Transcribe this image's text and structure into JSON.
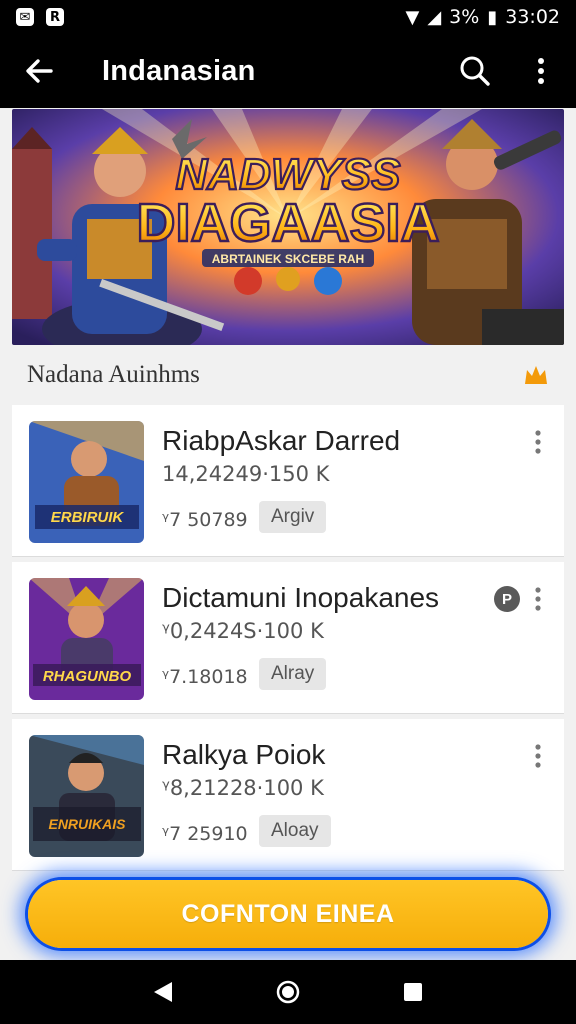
{
  "status_bar": {
    "battery": "3%",
    "time": "33:02"
  },
  "app_bar": {
    "title": "Indanasian"
  },
  "banner": {
    "title_line1": "NADWYSS",
    "title_line2": "DIAGAASIA",
    "subtitle": "ABRTAINEK SKCEBE RAH"
  },
  "section": {
    "title": "Nadana Auinhms"
  },
  "items": [
    {
      "title": "RiabpAskar Darred",
      "subtitle": "14,24249·150 K",
      "meta": "ᵞ7 50789",
      "chip": "Argiv",
      "thumb_text": "ERBIRUIK"
    },
    {
      "title": "Dictamuni Inopakanes",
      "subtitle": "ᵞ0,2424S·100 K",
      "meta": "ᵞ7.18018",
      "chip": "Alray",
      "thumb_text": "RHAGUNBO",
      "badge": "P"
    },
    {
      "title": "Ralkya Poiok",
      "subtitle": "ᵞ8,21228·100 K",
      "meta": "ᵞ7 25910",
      "chip": "Aloay",
      "thumb_text": "ENRUIKAIS"
    }
  ],
  "cta": {
    "label": "COFNTON EINEA"
  },
  "colors": {
    "accent": "#f6ae0a",
    "glow": "#1c5cf0",
    "bar": "#000000"
  }
}
